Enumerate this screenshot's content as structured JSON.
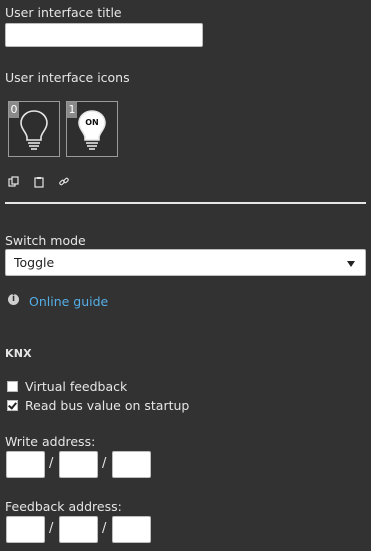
{
  "labels": {
    "ui_title": "User interface title",
    "ui_icons": "User interface icons",
    "switch_mode": "Switch mode",
    "online_guide": "Online guide",
    "section_knx": "KNX",
    "write_address": "Write address:",
    "feedback_address": "Feedback address:"
  },
  "ui_title_input": {
    "value": ""
  },
  "icons": [
    {
      "index": "0",
      "icon": "lightbulb-off-icon"
    },
    {
      "index": "1",
      "icon": "lightbulb-on-icon",
      "badge": "ON"
    }
  ],
  "tools": [
    "copy-icon",
    "clipboard-icon",
    "link-icon"
  ],
  "switch_mode": {
    "selected": "Toggle"
  },
  "checkboxes": [
    {
      "label": "Virtual feedback",
      "checked": false
    },
    {
      "label": "Read bus value on startup",
      "checked": true
    }
  ],
  "address_separator": "/",
  "colors": {
    "background": "#323232",
    "link": "#55aee6",
    "text": "#e6e6e6"
  }
}
